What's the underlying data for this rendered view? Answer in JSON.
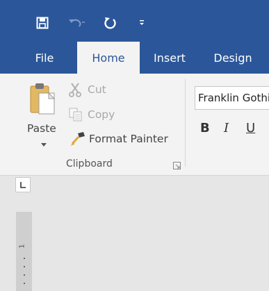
{
  "quick_access": {
    "save_icon": "save-icon",
    "undo_icon": "undo-icon",
    "redo_icon": "redo-icon",
    "customize_icon": "customize-qat-icon"
  },
  "tabs": [
    "File",
    "Home",
    "Insert",
    "Design"
  ],
  "active_tab": "Home",
  "clipboard": {
    "paste_label": "Paste",
    "cut_label": "Cut",
    "copy_label": "Copy",
    "format_painter_label": "Format Painter",
    "group_label": "Clipboard"
  },
  "font": {
    "font_name": "Franklin Gothic",
    "bold_label": "B",
    "italic_label": "I",
    "underline_label": "U"
  },
  "ruler": {
    "vertical_marker": "1"
  },
  "colors": {
    "accent": "#2b579a",
    "ribbon_bg": "#f3f3f3",
    "document_bg": "#e6e6e6"
  }
}
